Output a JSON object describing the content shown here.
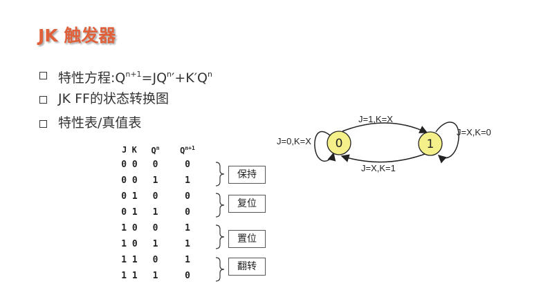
{
  "title": "JK 触发器",
  "bullets": [
    {
      "prefix": "特性方程:Q",
      "sup1": "n+1",
      "mid": "=JQ",
      "sup2": "n",
      "mid2": "′+K′Q",
      "sup3": "n"
    },
    {
      "text": "JK FF的状态转换图"
    },
    {
      "text": "特性表/真值表"
    }
  ],
  "table": {
    "headers": {
      "j": "J",
      "k": "K",
      "qn": "Q",
      "qn_sup": "n",
      "qn1": "Q",
      "qn1_sup": "n+1"
    },
    "rows": [
      {
        "j": "0",
        "k": "0",
        "qn": "0",
        "qn1": "0"
      },
      {
        "j": "0",
        "k": "0",
        "qn": "1",
        "qn1": "1"
      },
      {
        "j": "0",
        "k": "1",
        "qn": "0",
        "qn1": "0"
      },
      {
        "j": "0",
        "k": "1",
        "qn": "1",
        "qn1": "0"
      },
      {
        "j": "1",
        "k": "0",
        "qn": "0",
        "qn1": "1"
      },
      {
        "j": "1",
        "k": "0",
        "qn": "1",
        "qn1": "1"
      },
      {
        "j": "1",
        "k": "1",
        "qn": "0",
        "qn1": "1"
      },
      {
        "j": "1",
        "k": "1",
        "qn": "1",
        "qn1": "0"
      }
    ],
    "groups": [
      "保持",
      "复位",
      "置位",
      "翻转"
    ]
  },
  "state_diagram": {
    "states": [
      "0",
      "1"
    ],
    "self_loop_0": "J=0,K=X",
    "self_loop_1": "J=X,K=0",
    "edge_0_to_1": "J=1,K=X",
    "edge_1_to_0": "J=X,K=1",
    "state_fill": "#f5f08a"
  }
}
